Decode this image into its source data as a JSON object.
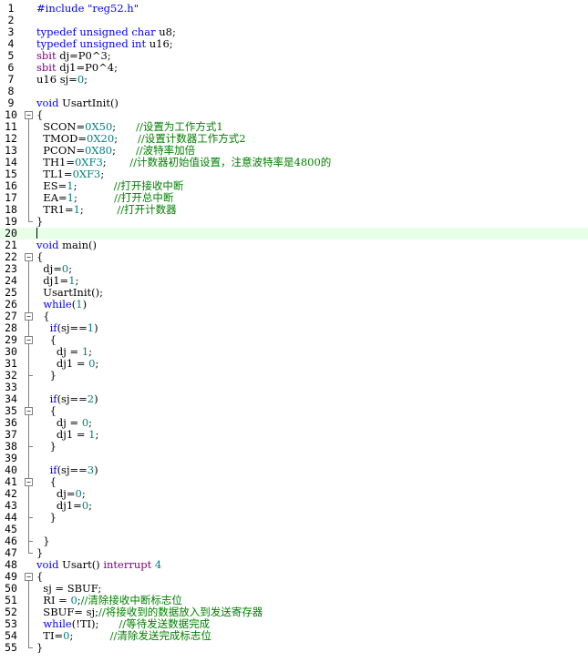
{
  "editor": {
    "lines": [
      {
        "n": "1",
        "parts": [
          [
            "pp",
            "#include \"reg52.h\""
          ]
        ]
      },
      {
        "n": "2",
        "parts": []
      },
      {
        "n": "3",
        "parts": [
          [
            "kw",
            "typedef"
          ],
          [
            "",
            " "
          ],
          [
            "kw",
            "unsigned"
          ],
          [
            "",
            " "
          ],
          [
            "kw",
            "char"
          ],
          [
            "",
            "",
            " u8;"
          ]
        ]
      },
      {
        "n": "4",
        "parts": [
          [
            "kw",
            "typedef"
          ],
          [
            "",
            "",
            " "
          ],
          [
            "kw",
            "unsigned"
          ],
          [
            "",
            "",
            " "
          ],
          [
            "kw",
            "int"
          ],
          [
            "",
            "",
            " u16;"
          ]
        ]
      },
      {
        "n": "5",
        "parts": [
          [
            "sb",
            "sbit"
          ],
          [
            "",
            "",
            " dj=P0^3;"
          ]
        ]
      },
      {
        "n": "6",
        "parts": [
          [
            "sb",
            "sbit"
          ],
          [
            "",
            "",
            " dj1=P0^4;"
          ]
        ]
      },
      {
        "n": "7",
        "parts": [
          [
            "",
            "",
            "u16 sj="
          ],
          [
            "num",
            "0"
          ],
          [
            "",
            "",
            ";"
          ]
        ]
      },
      {
        "n": "8",
        "parts": []
      },
      {
        "n": "9",
        "parts": [
          [
            "kw",
            "void"
          ],
          [
            "",
            "",
            " UsartInit()"
          ]
        ]
      },
      {
        "n": "10",
        "parts": [
          [
            "",
            "",
            "{"
          ]
        ]
      },
      {
        "n": "11",
        "parts": [
          [
            "",
            "",
            "  SCON="
          ],
          [
            "num",
            "0X50"
          ],
          [
            "",
            "",
            ";      "
          ],
          [
            "cm",
            "//设置为工作方式1"
          ]
        ]
      },
      {
        "n": "12",
        "parts": [
          [
            "",
            "",
            "  TMOD="
          ],
          [
            "num",
            "0X20"
          ],
          [
            "",
            "",
            ";      "
          ],
          [
            "cm",
            "//设置计数器工作方式2"
          ]
        ]
      },
      {
        "n": "13",
        "parts": [
          [
            "",
            "",
            "  PCON="
          ],
          [
            "num",
            "0X80"
          ],
          [
            "",
            "",
            ";      "
          ],
          [
            "cm",
            "//波特率加倍"
          ]
        ]
      },
      {
        "n": "14",
        "parts": [
          [
            "",
            "",
            "  TH1="
          ],
          [
            "num",
            "0XF3"
          ],
          [
            "",
            "",
            ";       "
          ],
          [
            "cm",
            "//计数器初始值设置，注意波特率是4800的"
          ]
        ]
      },
      {
        "n": "15",
        "parts": [
          [
            "",
            "",
            "  TL1="
          ],
          [
            "num",
            "0XF3"
          ],
          [
            "",
            "",
            ";"
          ]
        ]
      },
      {
        "n": "16",
        "parts": [
          [
            "",
            "",
            "  ES="
          ],
          [
            "num",
            "1"
          ],
          [
            "",
            "",
            ";           "
          ],
          [
            "cm",
            "//打开接收中断"
          ]
        ]
      },
      {
        "n": "17",
        "parts": [
          [
            "",
            "",
            "  EA="
          ],
          [
            "num",
            "1"
          ],
          [
            "",
            "",
            ";           "
          ],
          [
            "cm",
            "//打开总中断"
          ]
        ]
      },
      {
        "n": "18",
        "parts": [
          [
            "",
            "",
            "  TR1="
          ],
          [
            "num",
            "1"
          ],
          [
            "",
            "",
            ";          "
          ],
          [
            "cm",
            "//打开计数器"
          ]
        ]
      },
      {
        "n": "19",
        "parts": [
          [
            "",
            "",
            "}"
          ]
        ]
      },
      {
        "n": "20",
        "parts": []
      },
      {
        "n": "21",
        "parts": [
          [
            "kw",
            "void"
          ],
          [
            "",
            "",
            " main()"
          ]
        ]
      },
      {
        "n": "22",
        "parts": [
          [
            "",
            "",
            "{"
          ]
        ]
      },
      {
        "n": "23",
        "parts": [
          [
            "",
            "",
            "  dj="
          ],
          [
            "num",
            "0"
          ],
          [
            "",
            "",
            ";"
          ]
        ]
      },
      {
        "n": "24",
        "parts": [
          [
            "",
            "",
            "  dj1="
          ],
          [
            "num",
            "1"
          ],
          [
            "",
            "",
            ";"
          ]
        ]
      },
      {
        "n": "25",
        "parts": [
          [
            "",
            "",
            "  UsartInit();"
          ]
        ]
      },
      {
        "n": "26",
        "parts": [
          [
            "",
            "",
            "  "
          ],
          [
            "kw",
            "while"
          ],
          [
            "",
            "",
            "("
          ],
          [
            "num",
            "1"
          ],
          [
            "",
            "",
            ")"
          ]
        ]
      },
      {
        "n": "27",
        "parts": [
          [
            "",
            "",
            "  {"
          ]
        ]
      },
      {
        "n": "28",
        "parts": [
          [
            "",
            "",
            "    "
          ],
          [
            "kw",
            "if"
          ],
          [
            "",
            "",
            "(sj=="
          ],
          [
            "num",
            "1"
          ],
          [
            "",
            "",
            ")"
          ]
        ]
      },
      {
        "n": "29",
        "parts": [
          [
            "",
            "",
            "    {"
          ]
        ]
      },
      {
        "n": "30",
        "parts": [
          [
            "",
            "",
            "      dj = "
          ],
          [
            "num",
            "1"
          ],
          [
            "",
            "",
            ";"
          ]
        ]
      },
      {
        "n": "31",
        "parts": [
          [
            "",
            "",
            "      dj1 = "
          ],
          [
            "num",
            "0"
          ],
          [
            "",
            "",
            ";"
          ]
        ]
      },
      {
        "n": "32",
        "parts": [
          [
            "",
            "",
            "    }"
          ]
        ]
      },
      {
        "n": "33",
        "parts": []
      },
      {
        "n": "34",
        "parts": [
          [
            "",
            "",
            "    "
          ],
          [
            "kw",
            "if"
          ],
          [
            "",
            "",
            "(sj=="
          ],
          [
            "num",
            "2"
          ],
          [
            "",
            "",
            ")"
          ]
        ]
      },
      {
        "n": "35",
        "parts": [
          [
            "",
            "",
            "    {"
          ]
        ]
      },
      {
        "n": "36",
        "parts": [
          [
            "",
            "",
            "      dj = "
          ],
          [
            "num",
            "0"
          ],
          [
            "",
            "",
            ";"
          ]
        ]
      },
      {
        "n": "37",
        "parts": [
          [
            "",
            "",
            "      dj1 = "
          ],
          [
            "num",
            "1"
          ],
          [
            "",
            "",
            ";"
          ]
        ]
      },
      {
        "n": "38",
        "parts": [
          [
            "",
            "",
            "    }"
          ]
        ]
      },
      {
        "n": "39",
        "parts": []
      },
      {
        "n": "40",
        "parts": [
          [
            "",
            "",
            "    "
          ],
          [
            "kw",
            "if"
          ],
          [
            "",
            "",
            "(sj=="
          ],
          [
            "num",
            "3"
          ],
          [
            "",
            "",
            ")"
          ]
        ]
      },
      {
        "n": "41",
        "parts": [
          [
            "",
            "",
            "    {"
          ]
        ]
      },
      {
        "n": "42",
        "parts": [
          [
            "",
            "",
            "      dj="
          ],
          [
            "num",
            "0"
          ],
          [
            "",
            "",
            ";"
          ]
        ]
      },
      {
        "n": "43",
        "parts": [
          [
            "",
            "",
            "      dj1="
          ],
          [
            "num",
            "0"
          ],
          [
            "",
            "",
            ";"
          ]
        ]
      },
      {
        "n": "44",
        "parts": [
          [
            "",
            "",
            "    }"
          ]
        ]
      },
      {
        "n": "45",
        "parts": []
      },
      {
        "n": "46",
        "parts": [
          [
            "",
            "",
            "  }"
          ]
        ]
      },
      {
        "n": "47",
        "parts": [
          [
            "",
            "",
            "}"
          ]
        ]
      },
      {
        "n": "48",
        "parts": [
          [
            "kw",
            "void"
          ],
          [
            "",
            "",
            " Usart() "
          ],
          [
            "mg",
            "interrupt"
          ],
          [
            "",
            "",
            " "
          ],
          [
            "num",
            "4"
          ]
        ]
      },
      {
        "n": "49",
        "parts": [
          [
            "",
            "",
            "{"
          ]
        ]
      },
      {
        "n": "50",
        "parts": [
          [
            "",
            "",
            "  sj = SBUF;"
          ]
        ]
      },
      {
        "n": "51",
        "parts": [
          [
            "",
            "",
            "  RI = "
          ],
          [
            "num",
            "0"
          ],
          [
            "",
            "",
            ";"
          ],
          [
            "cm",
            "//清除接收中断标志位"
          ]
        ]
      },
      {
        "n": "52",
        "parts": [
          [
            "",
            "",
            "  SBUF= sj;"
          ],
          [
            "cm",
            "//将接收到的数据放入到发送寄存器"
          ]
        ]
      },
      {
        "n": "53",
        "parts": [
          [
            "",
            "",
            "  "
          ],
          [
            "kw",
            "while"
          ],
          [
            "",
            "",
            "(!TI);      "
          ],
          [
            "cm",
            "//等待发送数据完成"
          ]
        ]
      },
      {
        "n": "54",
        "parts": [
          [
            "",
            "",
            "  TI="
          ],
          [
            "num",
            "0"
          ],
          [
            "",
            "",
            ";           "
          ],
          [
            "cm",
            "//清除发送完成标志位"
          ]
        ]
      },
      {
        "n": "55",
        "parts": [
          [
            "",
            "",
            "}"
          ]
        ]
      }
    ]
  }
}
